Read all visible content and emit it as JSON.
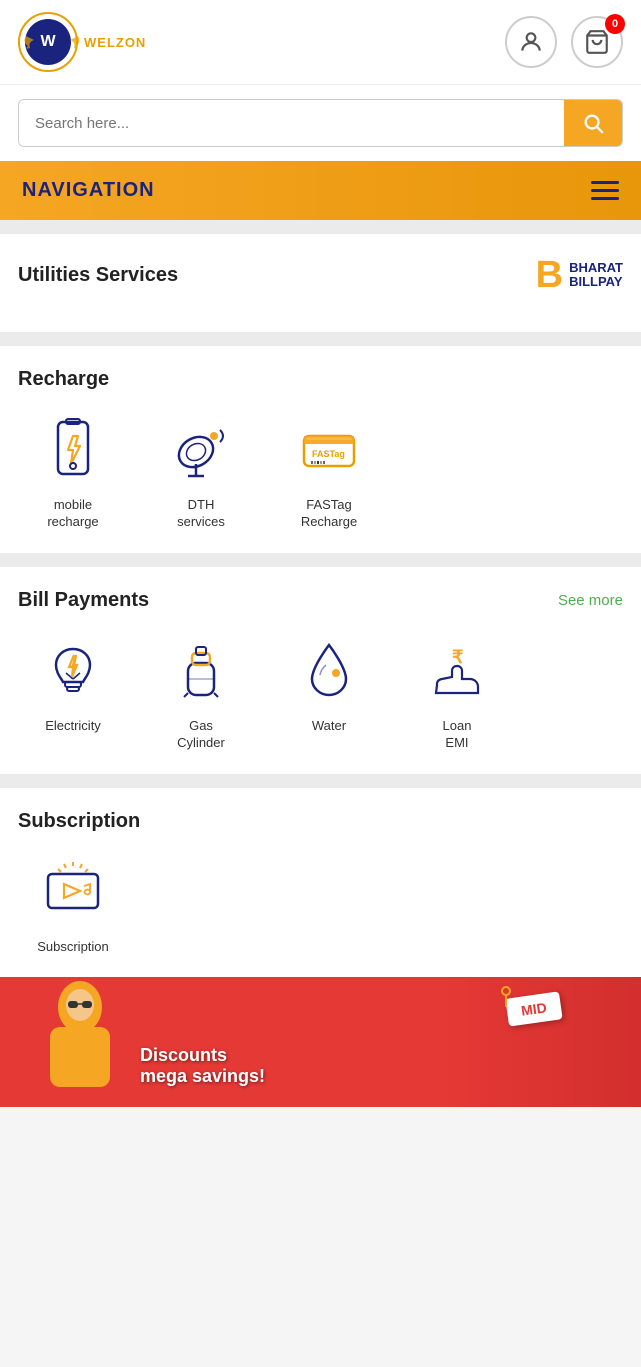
{
  "header": {
    "logo_alt": "Welzon Logo",
    "logo_letter": "W",
    "user_icon_label": "User Profile",
    "cart_icon_label": "Cart",
    "cart_badge": "0"
  },
  "search": {
    "placeholder": "Search here...",
    "button_label": "Search"
  },
  "nav": {
    "title": "NAVIGATION",
    "menu_label": "Menu"
  },
  "utilities": {
    "section_title": "Utilities Services",
    "bharat_b": "B",
    "bharat_line1": "BHARAT",
    "bharat_line2": "BILLPAY"
  },
  "recharge": {
    "section_title": "Recharge",
    "items": [
      {
        "id": "mobile-recharge",
        "label": "mobile\nrecharge"
      },
      {
        "id": "dth-services",
        "label": "DTH\nservices"
      },
      {
        "id": "fastag-recharge",
        "label": "FASTag\nRecharge"
      }
    ]
  },
  "bill_payments": {
    "section_title": "Bill Payments",
    "see_more_label": "See more",
    "items": [
      {
        "id": "electricity",
        "label": "Electricity"
      },
      {
        "id": "gas-cylinder",
        "label": "Gas\nCylinder"
      },
      {
        "id": "water",
        "label": "Water"
      },
      {
        "id": "loan-emi",
        "label": "Loan\nEMI"
      }
    ]
  },
  "subscription": {
    "section_title": "Subscription",
    "items": [
      {
        "id": "subscription",
        "label": "Subscription"
      }
    ]
  },
  "banner": {
    "line1": "Discounts",
    "line2": "mega savings!",
    "mid_label": "MID"
  }
}
